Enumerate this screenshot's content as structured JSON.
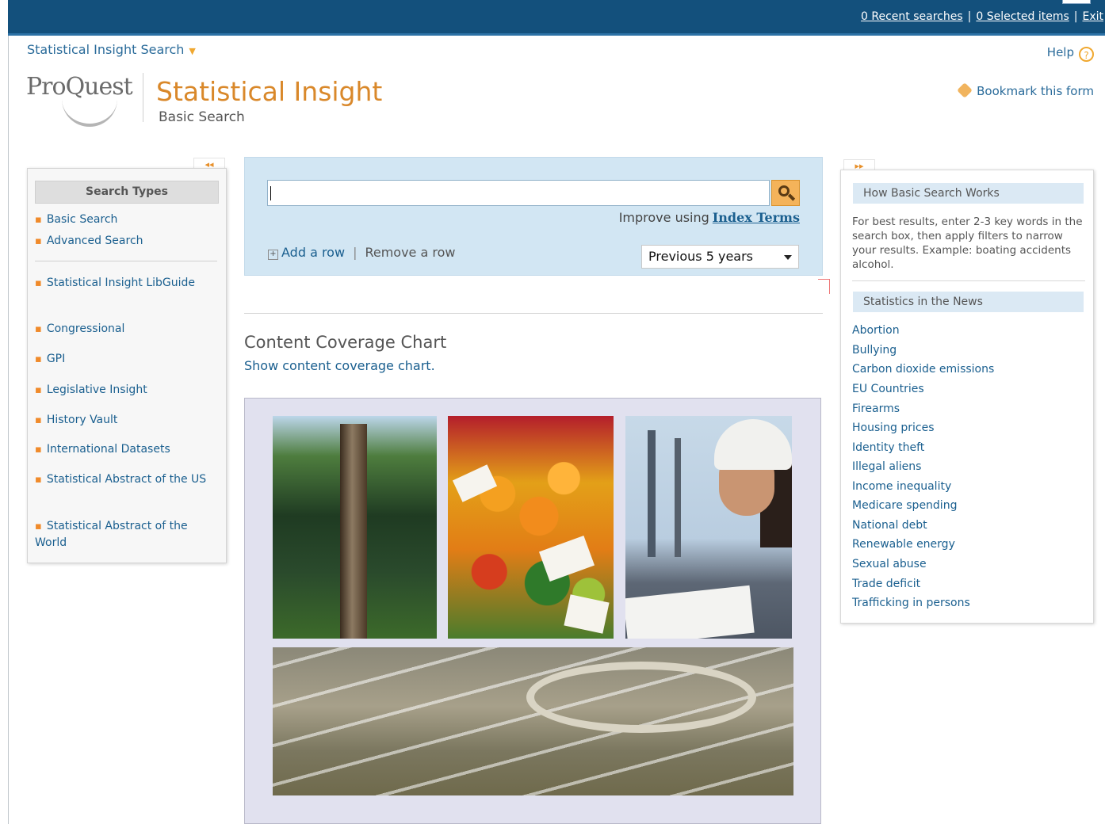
{
  "topbar": {
    "recent_searches": "0 Recent searches",
    "selected_items": "0 Selected items",
    "exit": "Exit",
    "separator": "|"
  },
  "header": {
    "app_switcher": "Statistical Insight Search",
    "help": "Help",
    "logo": "ProQuest",
    "product_title": "Statistical Insight",
    "product_subtitle": "Basic Search",
    "bookmark": "Bookmark this form"
  },
  "left_panel": {
    "collapse_glyph": "◂◂",
    "heading": "Search Types",
    "items": [
      "Basic Search",
      "Advanced Search",
      "Statistical Insight LibGuide",
      "Congressional",
      "GPI",
      "Legislative Insight",
      "History Vault",
      "International Datasets",
      "Statistical Abstract of the US",
      "Statistical Abstract of the World"
    ]
  },
  "search": {
    "query": "",
    "improve_text": "Improve using",
    "index_terms": "Index Terms",
    "add_row": "Add a row",
    "remove_row": "Remove a row",
    "row_separator": "|",
    "date_range": "Previous 5 years"
  },
  "content_coverage": {
    "title": "Content Coverage Chart",
    "link": "Show content coverage chart."
  },
  "right_panel": {
    "expand_glyph": "▸▸",
    "how_heading": "How Basic Search Works",
    "how_text": "For best results, enter 2-3 key words in the search box, then apply filters to narrow your results. Example: boating accidents alcohol.",
    "news_heading": "Statistics in the News",
    "news_items": [
      "Abortion",
      "Bullying",
      "Carbon dioxide emissions",
      "EU Countries",
      "Firearms",
      "Housing prices",
      "Identity theft",
      "Illegal aliens",
      "Income inequality",
      "Medicare spending",
      "National debt",
      "Renewable energy",
      "Sexual abuse",
      "Trade deficit",
      "Trafficking in persons"
    ]
  },
  "colors": {
    "topbar": "#13507c",
    "accent_orange": "#d9882a",
    "link_blue": "#1a5f8f",
    "search_panel": "#d2e6f3"
  }
}
